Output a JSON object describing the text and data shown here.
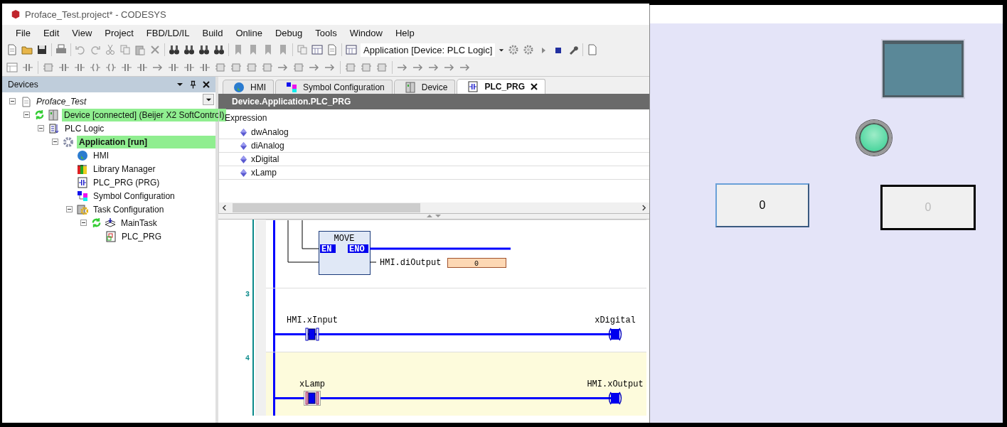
{
  "window": {
    "title": "Proface_Test.project* - CODESYS"
  },
  "menu": [
    "File",
    "Edit",
    "View",
    "Project",
    "FBD/LD/IL",
    "Build",
    "Online",
    "Debug",
    "Tools",
    "Window",
    "Help"
  ],
  "toolbar": {
    "application_selector": "Application [Device: PLC Logic]"
  },
  "devices_panel": {
    "title": "Devices",
    "tree": [
      {
        "label": "Proface_Test",
        "kind": "project",
        "expanded": true,
        "highlighted": false,
        "online": false,
        "children": [
          {
            "label": "Device [connected] (Beijer X2 SoftControl)",
            "kind": "device",
            "expanded": true,
            "highlighted": true,
            "online": true,
            "children": [
              {
                "label": "PLC Logic",
                "kind": "plc-logic",
                "expanded": true,
                "highlighted": false,
                "online": false,
                "children": [
                  {
                    "label": "Application [run]",
                    "kind": "application",
                    "expanded": true,
                    "highlighted": true,
                    "online": false,
                    "children": [
                      {
                        "label": "HMI",
                        "kind": "hmi",
                        "highlighted": false,
                        "online": false
                      },
                      {
                        "label": "Library Manager",
                        "kind": "library",
                        "highlighted": false,
                        "online": false
                      },
                      {
                        "label": "PLC_PRG (PRG)",
                        "kind": "pou",
                        "highlighted": false,
                        "online": false
                      },
                      {
                        "label": "Symbol Configuration",
                        "kind": "symbols",
                        "highlighted": false,
                        "online": false
                      },
                      {
                        "label": "Task Configuration",
                        "kind": "tasks",
                        "expanded": true,
                        "highlighted": false,
                        "online": false,
                        "children": [
                          {
                            "label": "MainTask",
                            "kind": "task",
                            "expanded": true,
                            "highlighted": false,
                            "online": true,
                            "children": [
                              {
                                "label": "PLC_PRG",
                                "kind": "pou-call",
                                "highlighted": false,
                                "online": false
                              }
                            ]
                          }
                        ]
                      }
                    ]
                  }
                ]
              }
            ]
          }
        ]
      }
    ]
  },
  "editor": {
    "tabs": [
      {
        "label": "HMI",
        "kind": "hmi",
        "selected": false
      },
      {
        "label": "Symbol Configuration",
        "kind": "symbols",
        "selected": false
      },
      {
        "label": "Device",
        "kind": "device",
        "selected": false
      },
      {
        "label": "PLC_PRG",
        "kind": "pou",
        "selected": true
      }
    ],
    "path": "Device.Application.PLC_PRG",
    "watch": {
      "header": "Expression",
      "rows": [
        "dwAnalog",
        "diAnalog",
        "xDigital",
        "xLamp"
      ]
    },
    "ladder": {
      "rungs": [
        {
          "kind": "move",
          "selected": false,
          "block": "MOVE",
          "input": "EN",
          "output": "ENO",
          "target": "HMI.diOutput",
          "value": "0"
        },
        {
          "kind": "contact-coil",
          "number": "3",
          "selected": false,
          "contact": "HMI.xInput",
          "coil": "xDigital",
          "contact_focused": false
        },
        {
          "kind": "contact-coil",
          "number": "4",
          "selected": true,
          "contact": "xLamp",
          "coil": "HMI.xOutput",
          "contact_focused": true
        }
      ]
    }
  },
  "hmi_screen": {
    "lamp": {
      "on": true
    },
    "input_field": {
      "value": "0"
    },
    "output_field": {
      "value": "0",
      "disabled": true
    }
  }
}
